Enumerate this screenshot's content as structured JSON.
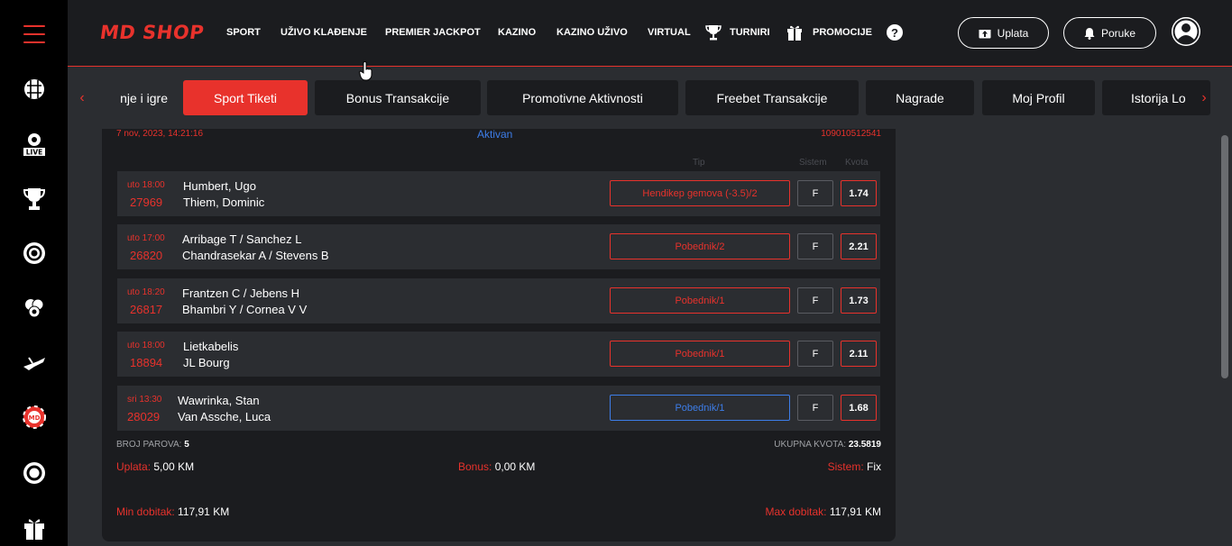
{
  "header": {
    "logo": "MD SHOP",
    "nav": [
      "SPORT",
      "UŽIVO KLAĐENJE",
      "PREMIER JACKPOT",
      "KAZINO",
      "KAZINO UŽIVO",
      "VIRTUAL",
      "TURNIRI",
      "PROMOCIJE"
    ],
    "help": "?",
    "deposit_label": "Uplata",
    "messages_label": "Poruke"
  },
  "tabs": [
    "nje i igre",
    "Sport Tiketi",
    "Bonus Transakcije",
    "Promotivne Aktivnosti",
    "Freebet Transakcije",
    "Nagrade",
    "Moj Profil",
    "Istorija Lo"
  ],
  "ticket": {
    "date": "7 nov, 2023, 14:21:16",
    "status": "Aktivan",
    "id": "109010512541",
    "col_tip": "Tip",
    "col_sistem": "Sistem",
    "col_kvota": "Kvota",
    "matches": [
      {
        "time": "uto 18:00",
        "code": "27969",
        "home": "Humbert, Ugo",
        "away": "Thiem, Dominic",
        "tip": "Hendikep gemova (-3.5)/2",
        "sistem": "F",
        "kvota": "1.74"
      },
      {
        "time": "uto 17:00",
        "code": "26820",
        "home": "Arribage T / Sanchez L",
        "away": "Chandrasekar A / Stevens B",
        "tip": "Pobednik/2",
        "sistem": "F",
        "kvota": "2.21"
      },
      {
        "time": "uto 18:20",
        "code": "26817",
        "home": "Frantzen C / Jebens H",
        "away": "Bhambri Y / Cornea V V",
        "tip": "Pobednik/1",
        "sistem": "F",
        "kvota": "1.73"
      },
      {
        "time": "uto 18:00",
        "code": "18894",
        "home": "Lietkabelis",
        "away": "JL Bourg",
        "tip": "Pobednik/1",
        "sistem": "F",
        "kvota": "2.11"
      },
      {
        "time": "sri 13:30",
        "code": "28029",
        "home": "Wawrinka, Stan",
        "away": "Van Assche, Luca",
        "tip": "Pobednik/1",
        "sistem": "F",
        "kvota": "1.68"
      }
    ],
    "broj_parova_label": "BROJ PAROVA:",
    "broj_parova": "5",
    "ukupna_kvota_label": "UKUPNA KVOTA:",
    "ukupna_kvota": "23.5819",
    "uplata_label": "Uplata:",
    "uplata": "5,00 KM",
    "bonus_label": "Bonus:",
    "bonus": "0,00 KM",
    "sistem_label": "Sistem:",
    "sistem": "Fix",
    "min_label": "Min dobitak:",
    "min": "117,91 KM",
    "max_label": "Max dobitak:",
    "max": "117,91 KM"
  },
  "colors": {
    "accent": "#e8322c",
    "blue": "#3d7de8",
    "panel": "#1b1c1f",
    "bg": "#2b2d31"
  }
}
